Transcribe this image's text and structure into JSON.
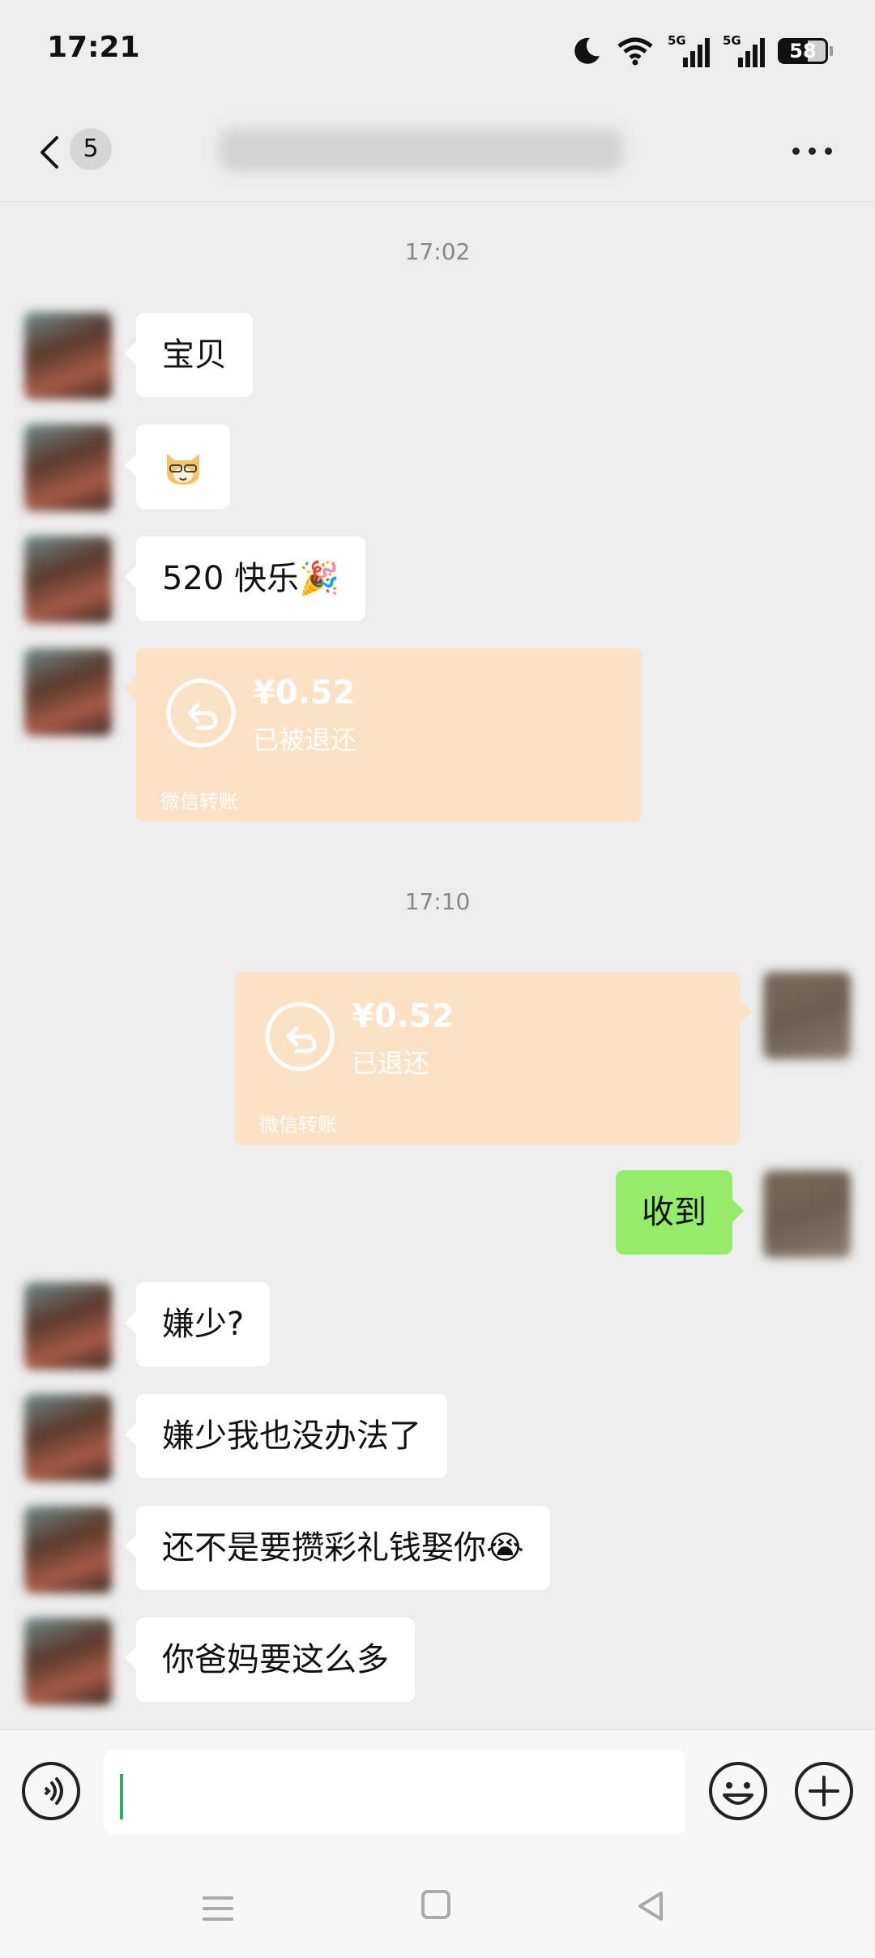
{
  "status_bar": {
    "time": "17:21",
    "network_1": "5G",
    "network_2": "5G",
    "battery": "58"
  },
  "header": {
    "unread_count": "5"
  },
  "messages": {
    "time_1": "17:02",
    "msg_1": "宝贝",
    "msg_2": "🐱",
    "msg_3": "520 快乐🎉",
    "transfer_1": {
      "amount": "¥0.52",
      "status": "已被退还",
      "footer": "微信转账"
    },
    "time_2": "17:10",
    "transfer_2": {
      "amount": "¥0.52",
      "status": "已退还",
      "footer": "微信转账"
    },
    "msg_4": "收到",
    "msg_5": "嫌少?",
    "msg_6": "嫌少我也没办法了",
    "msg_7": "还不是要攒彩礼钱娶你😭",
    "msg_8": "你爸妈要这么多"
  },
  "input": {
    "value": ""
  },
  "colors": {
    "background": "#ededed",
    "my_bubble": "#95ec69",
    "their_bubble": "#ffffff",
    "transfer_card": "#fbe2c4",
    "cursor": "#2aae67"
  },
  "icons": [
    "back-arrow-icon",
    "more-icon",
    "voice-icon",
    "emoji-icon",
    "plus-icon",
    "refund-icon",
    "moon-icon",
    "wifi-icon",
    "signal-icon",
    "battery-icon",
    "menu-icon",
    "home-icon",
    "back-triangle-icon"
  ]
}
